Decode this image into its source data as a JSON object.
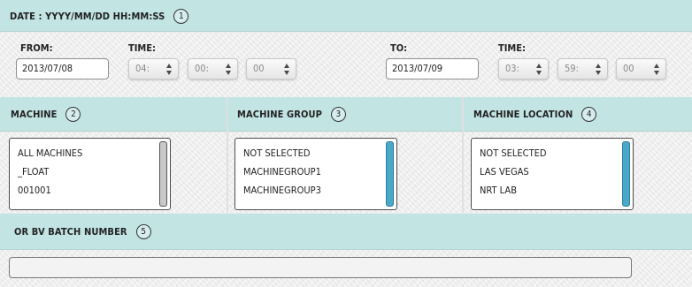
{
  "date_section": {
    "title": "DATE : YYYY/MM/DD HH:MM:SS",
    "badge": "1",
    "from_label": "FROM:",
    "from_date": "2013/07/08",
    "from_time_label": "TIME:",
    "from_hour": "04:",
    "from_minute": "00:",
    "from_second": "00",
    "to_label": "TO:",
    "to_date": "2013/07/09",
    "to_time_label": "TIME:",
    "to_hour": "03:",
    "to_minute": "59:",
    "to_second": "00"
  },
  "machine": {
    "title": "MACHINE",
    "badge": "2",
    "items": [
      "ALL MACHINES",
      "_FLOAT",
      "001001"
    ]
  },
  "machine_group": {
    "title": "MACHINE GROUP",
    "badge": "3",
    "items": [
      "NOT SELECTED",
      "MACHINEGROUP1",
      "MACHINEGROUP3"
    ]
  },
  "machine_location": {
    "title": "MACHINE LOCATION",
    "badge": "4",
    "items": [
      "NOT SELECTED",
      "LAS VEGAS",
      "NRT LAB"
    ]
  },
  "batch": {
    "title": "OR BV BATCH NUMBER",
    "badge": "5",
    "value": ""
  },
  "colors": {
    "header_band": "#c2e4e3",
    "scrollbar_accent": "#4aa8c8"
  }
}
